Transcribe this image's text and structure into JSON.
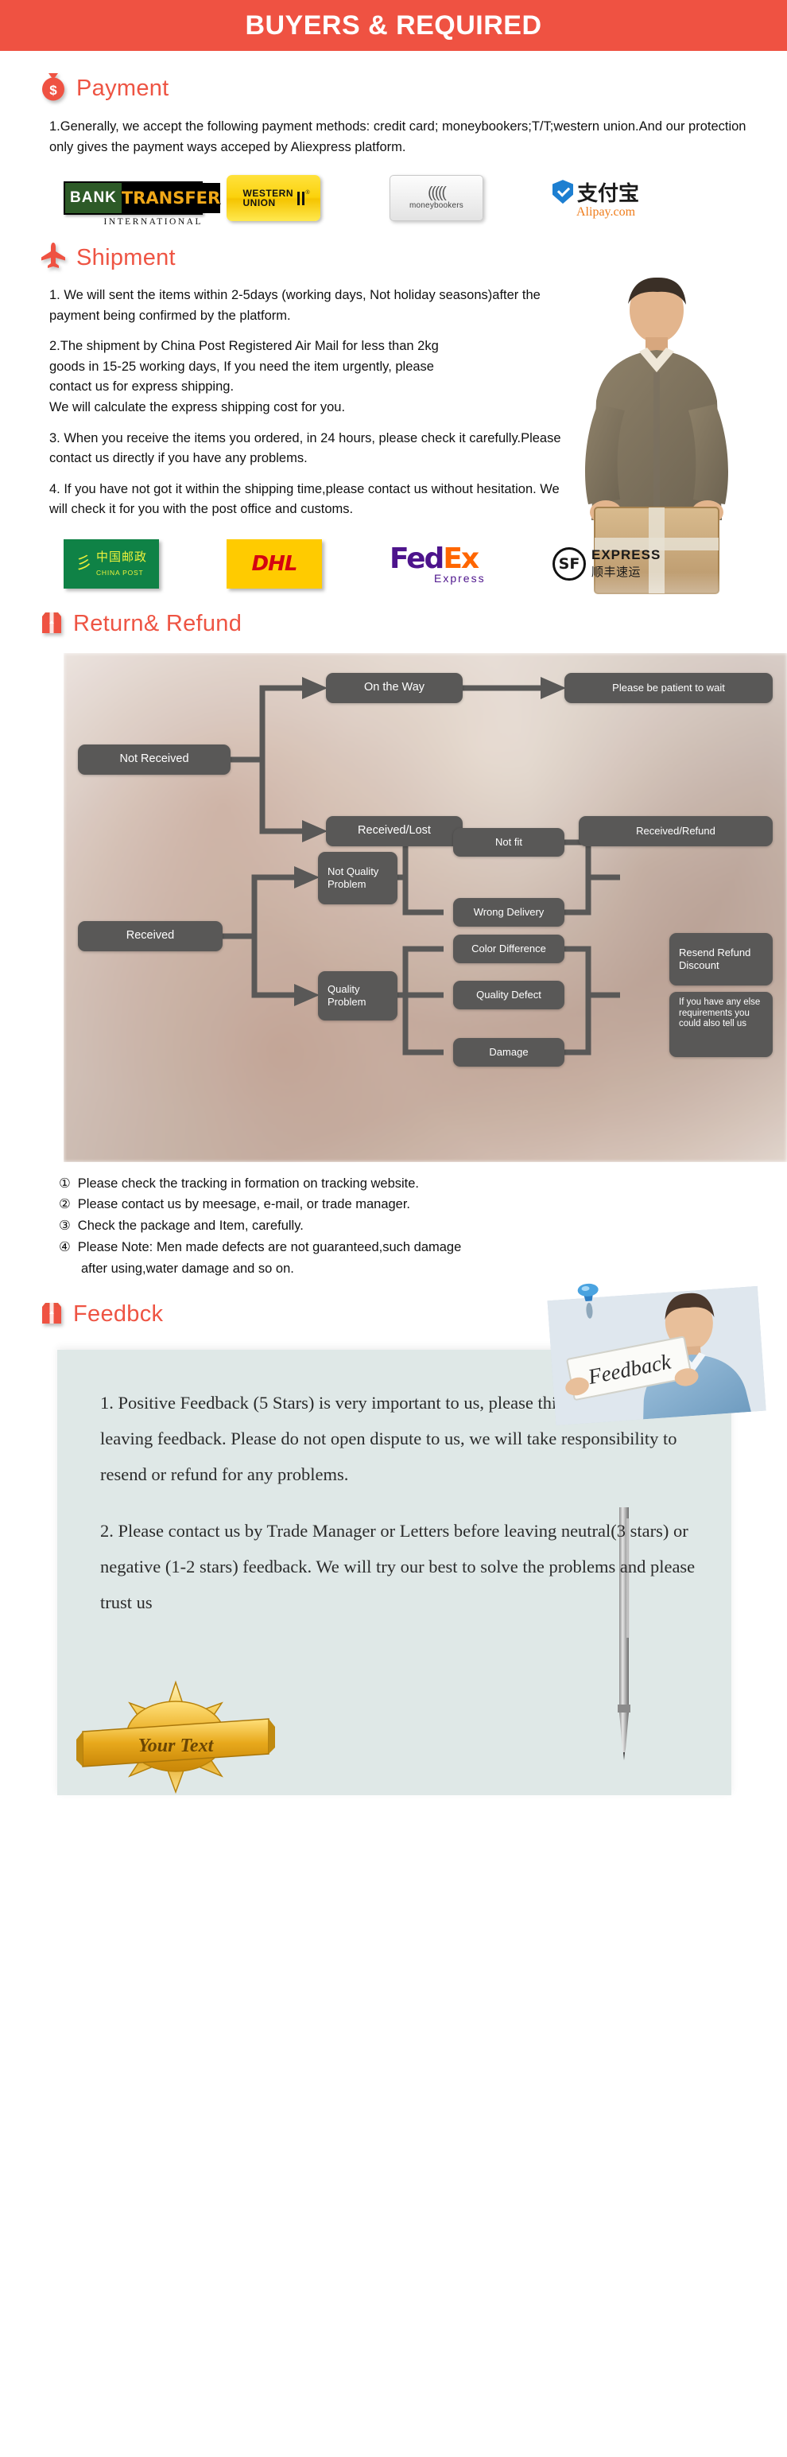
{
  "header": {
    "title": "BUYERS & REQUIRED"
  },
  "theme": {
    "accent": "#ef5242",
    "heading_color": "#ee5443",
    "node_gray": "#595857",
    "feedback_panel_bg": "#dfe8e7"
  },
  "payment": {
    "icon": "money-bag-icon",
    "heading": "Payment",
    "paragraphs": [
      "1.Generally, we accept the following payment methods: credit card; moneybookers;T/T;western union.And our protection only gives the payment ways acceped by Aliexpress platform."
    ],
    "logos": [
      {
        "name": "bank-transfer-international-logo",
        "line1": "BANK",
        "line2": "TRANSFER",
        "line3": "INTERNATIONAL"
      },
      {
        "name": "western-union-logo",
        "line1": "WESTERN",
        "line2": "UNION",
        "mark": "®"
      },
      {
        "name": "moneybookers-logo",
        "label": "moneybookers"
      },
      {
        "name": "alipay-logo",
        "cn": "支付宝",
        "domain": "Alipay.com"
      }
    ]
  },
  "shipment": {
    "icon": "airplane-icon",
    "heading": "Shipment",
    "paragraphs": [
      "1. We will sent the items within 2-5days (working days, Not holiday seasons)after the payment being confirmed by the platform.",
      "2.The shipment by China Post Registered Air Mail for less than  2kg goods in 15-25 working days, If  you need the item urgently, please contact us for express shipping.\nWe will calculate the express shipping cost for you.",
      "3. When you receive the items you ordered, in 24 hours, please check it carefully.Please contact us directly if you have any problems.",
      "4. If you have not got it within the shipping time,please contact us without hesitation. We will check it for you with the post office and customs."
    ],
    "para2_line1": "2.The shipment by China Post Registered Air Mail for less than  2kg",
    "para2_line2": "goods in 15-25 working days, If  you need the item urgently, please",
    "para2_line3": "contact us for express shipping.",
    "para2_line4": "We will calculate the express shipping cost for you.",
    "courier_photo_alt": "delivery-courier-photo",
    "logos": [
      {
        "name": "china-post-logo",
        "cn": "中国邮政",
        "en": "CHINA POST"
      },
      {
        "name": "dhl-logo",
        "label": "DHL"
      },
      {
        "name": "fedex-logo",
        "part1": "Fed",
        "part2": "Ex",
        "sub": "Express"
      },
      {
        "name": "sf-express-logo",
        "badge": "SF",
        "w1": "EXPRESS",
        "w2": "顺丰速运"
      }
    ]
  },
  "returns": {
    "icon": "gift-box-icon",
    "heading": "Return& Refund",
    "flow_nodes": [
      {
        "id": "not-received",
        "label": "Not Received"
      },
      {
        "id": "on-the-way",
        "label": "On the Way"
      },
      {
        "id": "please-be-patient",
        "label": "Please be patient to wait"
      },
      {
        "id": "received-lost",
        "label": "Received/Lost"
      },
      {
        "id": "received-refund",
        "label": "Received/Refund"
      },
      {
        "id": "received",
        "label": "Received"
      },
      {
        "id": "not-quality-problem",
        "label": "Not Quality Problem"
      },
      {
        "id": "quality-problem",
        "label": "Quality Problem"
      },
      {
        "id": "not-fit",
        "label": "Not fit"
      },
      {
        "id": "wrong-delivery",
        "label": "Wrong Delivery"
      },
      {
        "id": "color-difference",
        "label": "Color Difference"
      },
      {
        "id": "quality-defect",
        "label": "Quality Defect"
      },
      {
        "id": "damage",
        "label": "Damage"
      },
      {
        "id": "resend-refund-discount",
        "label": "Resend Refund Discount"
      },
      {
        "id": "tell-us",
        "label": "If you have any else requirements you could also tell us"
      }
    ],
    "notes": [
      {
        "num": "①",
        "text": "Please check the tracking in formation on tracking website."
      },
      {
        "num": "②",
        "text": "Please contact us by meesage, e-mail, or trade manager."
      },
      {
        "num": "③",
        "text": "Check the package and Item, carefully."
      },
      {
        "num": "④",
        "text": "Please Note: Men made defects  are not guaranteed,such damage"
      }
    ],
    "note4_cont": "after using,water damage and so on."
  },
  "feedback": {
    "icon": "gift-box-icon",
    "heading": "Feedbck",
    "photo_label": "Feedback",
    "photo_alt": "woman-holding-feedback-sign-photo",
    "paragraphs": [
      "1. Positive Feedback (5 Stars) is very important to us, please think twice before leaving feedback. Please do not open dispute to us,   we will take responsibility to resend or refund for any problems.",
      "2. Please contact us by Trade Manager or Letters before leaving neutral(3 stars) or negative (1-2 stars) feedback. We will try our best to solve the problems and please trust us"
    ],
    "ribbon_text": "Your Text",
    "pen_alt": "pen-illustration"
  }
}
